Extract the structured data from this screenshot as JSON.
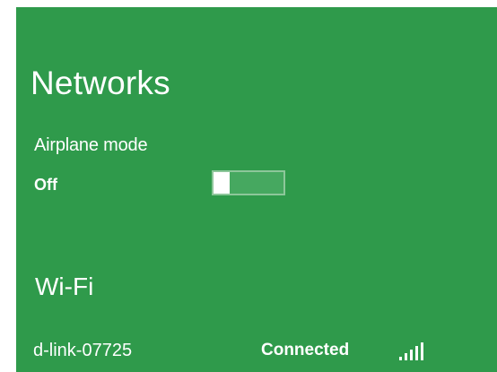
{
  "networks_panel": {
    "title": "Networks",
    "airplane_mode": {
      "label": "Airplane mode",
      "state": "Off"
    },
    "wifi_section": {
      "heading": "Wi-Fi",
      "networks": [
        {
          "name": "d-link-07725",
          "status": "Connected",
          "signal_icon": "signal-strength-icon"
        }
      ]
    }
  },
  "colors": {
    "panel_background": "#2f9a4b",
    "text": "#ffffff",
    "toggle_track": "#46a860",
    "toggle_border": "#8dc79a"
  }
}
